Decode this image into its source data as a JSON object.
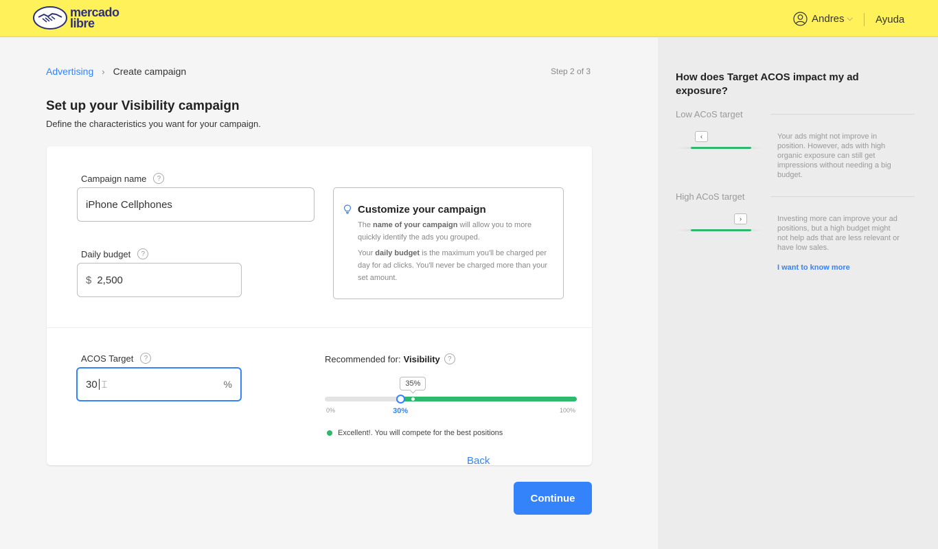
{
  "header": {
    "logo_text_line1": "mercado",
    "logo_text_line2": "libre",
    "user_name": "Andres",
    "help_label": "Ayuda"
  },
  "breadcrumb": {
    "parent": "Advertising",
    "current": "Create campaign",
    "step": "Step 2 of 3"
  },
  "page": {
    "title": "Set up your Visibility campaign",
    "subtitle": "Define the characteristics you want for your campaign."
  },
  "form": {
    "campaign_name_label": "Campaign name",
    "campaign_name_value": "iPhone Cellphones",
    "daily_budget_label": "Daily budget",
    "currency": "$",
    "daily_budget_value": "2,500",
    "acos_label": "ACOS Target",
    "acos_value": "30",
    "acos_suffix": "%"
  },
  "tip": {
    "title": "Customize your campaign",
    "p1_pre": "The ",
    "p1_bold": "name of your campaign",
    "p1_post": " will allow you to more quickly identify the ads you grouped.",
    "p2_pre": "Your ",
    "p2_bold": "daily budget",
    "p2_post": " is the maximum you'll be charged per day for ad clicks. You'll never be charged more than your set amount."
  },
  "acos_slider": {
    "recommended_prefix": "Recommended for:",
    "recommended_value": "Visibility",
    "recommended_bubble": "35%",
    "recommended_percent": 35,
    "current_percent": 30,
    "current_label": "30%",
    "min_label": "0%",
    "max_label": "100%",
    "status_text": "Excellent!. You will compete for the best positions",
    "status_color": "#2fb86b"
  },
  "actions": {
    "back_label": "Back",
    "continue_label": "Continue"
  },
  "sidebar": {
    "title": "How does Target ACOS impact my ad exposure?",
    "low_heading": "Low ACoS target",
    "low_text": "Your ads might not improve in position. However, ads with high organic exposure can still get impressions without needing a big budget.",
    "low_chip": "‹",
    "high_heading": "High ACoS target",
    "high_text": "Investing more can improve your ad positions, but a high budget might not help ads that are less relevant or have low sales.",
    "high_chip": "›",
    "link": "I want to know more"
  },
  "colors": {
    "header_bg": "#fff159",
    "accent": "#3483fa",
    "success": "#2fb86b"
  }
}
